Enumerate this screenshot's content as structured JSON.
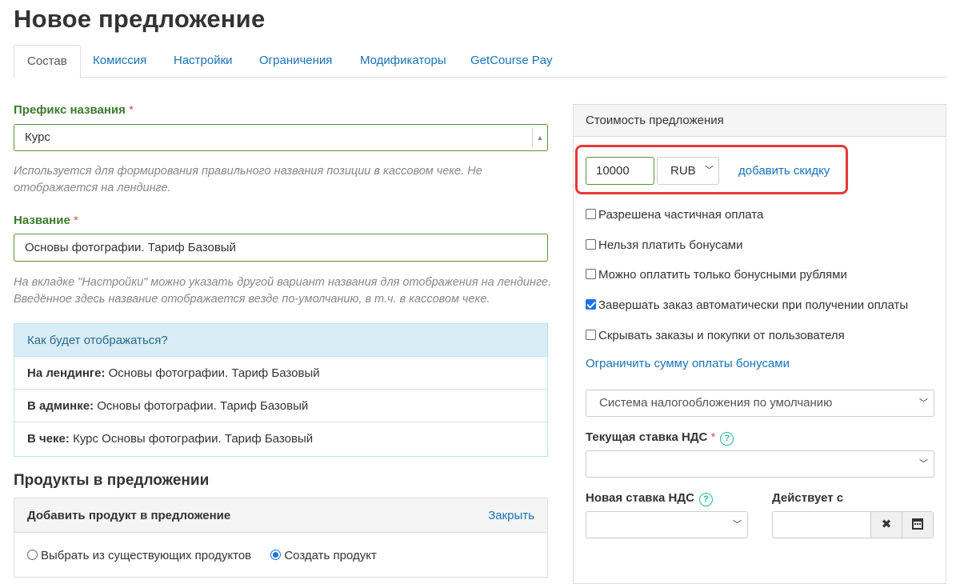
{
  "page": {
    "title": "Новое предложение"
  },
  "tabs": [
    "Состав",
    "Комиссия",
    "Настройки",
    "Ограничения",
    "Модификаторы",
    "GetCourse Pay"
  ],
  "prefix": {
    "label": "Префикс названия",
    "required_mark": "*",
    "value": "Курс",
    "help": "Используется для формирования правильного названия позиции в кассовом чеке. Не отображается на лендинге."
  },
  "name": {
    "label": "Название",
    "required_mark": "*",
    "value": "Основы фотографии. Тариф Базовый",
    "help": "На вкладке \"Настройки\" можно указать другой вариант названия для отображения на лендинге. Введённое здесь название отображается везде по-умолчанию, в т.ч. в кассовом чеке."
  },
  "preview": {
    "title": "Как будет отображаться?",
    "rows": [
      {
        "label": "На лендинге:",
        "value": "Основы фотографии. Тариф Базовый"
      },
      {
        "label": "В админке:",
        "value": "Основы фотографии. Тариф Базовый"
      },
      {
        "label": "В чеке:",
        "value": "Курс Основы фотографии. Тариф Базовый"
      }
    ]
  },
  "products": {
    "section_title": "Продукты в предложении",
    "panel_title": "Добавить продукт в предложение",
    "close_label": "Закрыть",
    "radio_existing": "Выбрать из существующих продуктов",
    "radio_create": "Создать продукт",
    "selected": "create"
  },
  "price": {
    "card_title": "Стоимость предложения",
    "amount": "10000",
    "currency": "RUB",
    "discount_link": "добавить скидку",
    "options": [
      {
        "label": "Разрешена частичная оплата",
        "checked": false
      },
      {
        "label": "Нельзя платить бонусами",
        "checked": false
      },
      {
        "label": "Можно оплатить только бонусными рублями",
        "checked": false
      },
      {
        "label": "Завершать заказ автоматически при получении оплаты",
        "checked": true
      },
      {
        "label": "Скрывать заказы и покупки от пользователя",
        "checked": false
      }
    ],
    "limit_link": "Ограничить сумму оплаты бонусами",
    "tax_system": "Система налогообложения по умолчанию",
    "vat_current_label": "Текущая ставка НДС",
    "vat_current_required": "*",
    "vat_current_value": "",
    "vat_new_label": "Новая ставка НДС",
    "vat_new_value": "",
    "effective_label": "Действует с",
    "effective_value": "",
    "help_icon": "question-circle-icon",
    "clear_icon": "close-icon",
    "calendar_icon": "calendar-icon"
  }
}
